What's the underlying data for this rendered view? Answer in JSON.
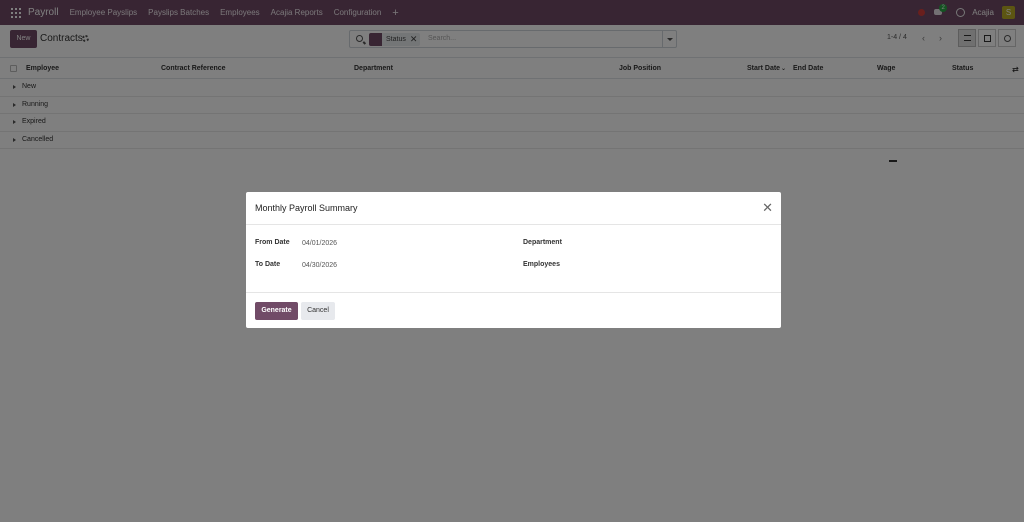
{
  "navbar": {
    "brand": "Payroll",
    "items": [
      "Employee Payslips",
      "Payslips Batches",
      "Employees",
      "Acajia Reports",
      "Configuration"
    ],
    "plus": "+",
    "chat_badge": "2",
    "company": "Acajia",
    "avatar_letter": "S"
  },
  "control": {
    "new_label": "New",
    "title": "Contracts",
    "facet_label": "Status",
    "search_placeholder": "Search...",
    "pager": "1-4 / 4"
  },
  "list": {
    "columns": [
      "Employee",
      "Contract Reference",
      "Department",
      "Job Position",
      "Start Date",
      "End Date",
      "Wage",
      "Status"
    ],
    "groups": [
      "New",
      "Running",
      "Expired",
      "Cancelled"
    ]
  },
  "modal": {
    "title": "Monthly Payroll Summary",
    "from_label": "From Date",
    "from_value": "04/01/2026",
    "to_label": "To Date",
    "to_value": "04/30/2026",
    "department_label": "Department",
    "employees_label": "Employees",
    "generate_label": "Generate",
    "cancel_label": "Cancel"
  }
}
